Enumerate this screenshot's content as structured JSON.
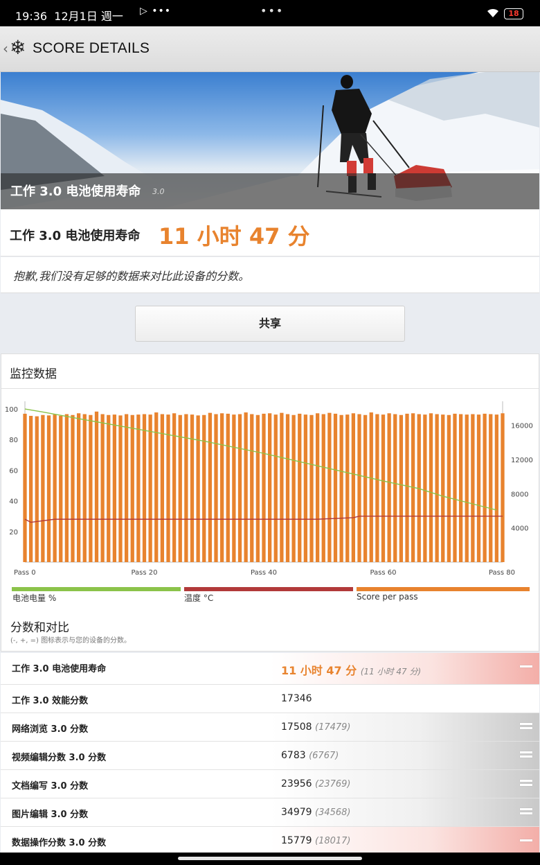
{
  "status_bar": {
    "time": "19:36",
    "date": "12月1日",
    "weekday": "週一",
    "battery": "18"
  },
  "app_bar": {
    "title": "SCORE DETAILS",
    "icons": [
      "back-chevron-icon",
      "snowflake-logo-icon"
    ]
  },
  "hero": {
    "title": "工作 3.0 电池使用寿命",
    "version": "3.0"
  },
  "result": {
    "label": "工作 3.0 电池使用寿命",
    "value": "11 小时 47 分",
    "value_color": "#e8832e"
  },
  "notice": "抱歉,我们没有足够的数据来对比此设备的分数。",
  "share_label": "共享",
  "monitor": {
    "title": "监控数据",
    "scores_title": "分数和对比",
    "scores_subtitle": "(-, +, =) 图标表示与您的设备的分数。"
  },
  "chart_data": {
    "type": "bar",
    "x_tick_labels": [
      "Pass 0",
      "Pass 20",
      "Pass 40",
      "Pass 60",
      "Pass 80"
    ],
    "x_range": [
      0,
      80
    ],
    "left_axis": {
      "ticks": [
        20,
        40,
        60,
        80,
        100
      ],
      "range": [
        0,
        105
      ]
    },
    "right_axis": {
      "ticks": [
        4000,
        8000,
        12000,
        16000
      ],
      "range": [
        0,
        18800
      ]
    },
    "grid": false,
    "legend_position": "bottom",
    "series": [
      {
        "name": "Score per pass",
        "type": "bar",
        "axis": "right",
        "color": "#e8832e",
        "values": [
          17346,
          17100,
          17050,
          17200,
          17150,
          17250,
          17100,
          17300,
          17200,
          17400,
          17300,
          17200,
          17600,
          17300,
          17200,
          17250,
          17150,
          17300,
          17200,
          17250,
          17300,
          17250,
          17500,
          17300,
          17250,
          17400,
          17200,
          17300,
          17250,
          17150,
          17200,
          17450,
          17300,
          17400,
          17350,
          17250,
          17300,
          17500,
          17300,
          17200,
          17350,
          17400,
          17250,
          17450,
          17300,
          17200,
          17350,
          17250,
          17200,
          17400,
          17300,
          17450,
          17350,
          17200,
          17250,
          17400,
          17300,
          17200,
          17500,
          17300,
          17250,
          17400,
          17300,
          17200,
          17350,
          17400,
          17300,
          17250,
          17400,
          17300,
          17250,
          17200,
          17350,
          17300,
          17250,
          17300,
          17250,
          17350,
          17300,
          17250,
          17400
        ]
      },
      {
        "name": "电池电量 %",
        "type": "line",
        "axis": "left",
        "color": "#8bc34a",
        "x": [
          0,
          3,
          10,
          20,
          30,
          40,
          50,
          60,
          66,
          70,
          76,
          79
        ],
        "values": [
          100,
          98,
          93,
          86,
          79,
          71,
          62,
          53,
          48,
          43,
          37,
          34
        ]
      },
      {
        "name": "温度 °C",
        "type": "line",
        "axis": "left",
        "color": "#b23a3a",
        "x": [
          0,
          1,
          5,
          49,
          55,
          56,
          80
        ],
        "values": [
          28,
          26,
          28,
          28,
          29,
          30,
          30
        ]
      }
    ]
  },
  "comparison": {
    "rows": [
      {
        "name": "工作 3.0 电池使用寿命",
        "value": "11 小时 47 分",
        "ref": "(11 小时 47 分)",
        "style": "red",
        "icon": "minus-icon"
      },
      {
        "name": "工作 3.0 效能分数",
        "value": "17346",
        "ref": "",
        "style": "none",
        "icon": ""
      },
      {
        "name": "网络浏览 3.0 分数",
        "value": "17508",
        "ref": "(17479)",
        "style": "gray",
        "icon": "equal-icon"
      },
      {
        "name": "视频编辑分数 3.0 分数",
        "value": "6783",
        "ref": "(6767)",
        "style": "gray",
        "icon": "equal-icon"
      },
      {
        "name": "文档编写 3.0 分数",
        "value": "23956",
        "ref": "(23769)",
        "style": "gray",
        "icon": "equal-icon"
      },
      {
        "name": "图片编辑 3.0 分数",
        "value": "34979",
        "ref": "(34568)",
        "style": "gray",
        "icon": "equal-icon"
      },
      {
        "name": "数据操作分数 3.0 分数",
        "value": "15779",
        "ref": "(18017)",
        "style": "red",
        "icon": "minus-icon"
      }
    ]
  }
}
